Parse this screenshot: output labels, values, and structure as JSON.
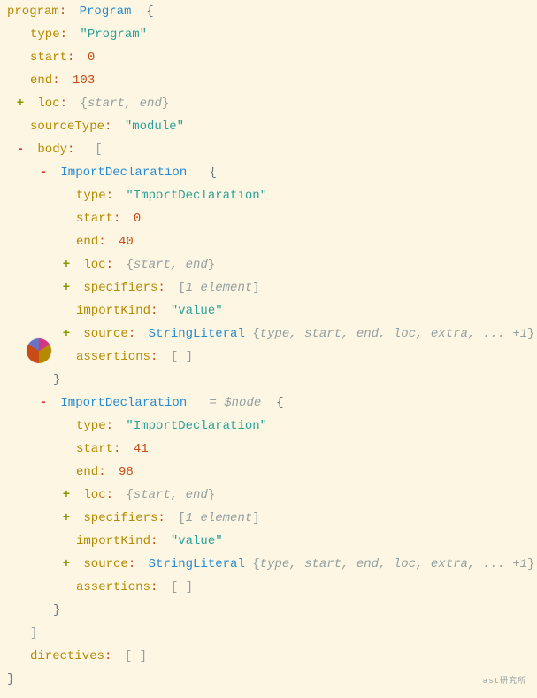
{
  "root": {
    "key": "program",
    "type_name": "Program",
    "open": "{",
    "children": [
      {
        "key": "type",
        "value": "\"Program\"",
        "kind": "string"
      },
      {
        "key": "start",
        "value": "0",
        "kind": "number"
      },
      {
        "key": "end",
        "value": "103",
        "kind": "number"
      },
      {
        "key": "loc",
        "pm": "+",
        "preview": "{start, end}",
        "kind": "object-preview"
      },
      {
        "key": "sourceType",
        "value": "\"module\"",
        "kind": "string"
      },
      {
        "key": "body",
        "pm": "-",
        "value": "[",
        "kind": "array-open",
        "children": [
          {
            "type_name": "ImportDeclaration",
            "pm": "-",
            "open": "{",
            "children": [
              {
                "key": "type",
                "value": "\"ImportDeclaration\"",
                "kind": "string"
              },
              {
                "key": "start",
                "value": "0",
                "kind": "number"
              },
              {
                "key": "end",
                "value": "40",
                "kind": "number"
              },
              {
                "key": "loc",
                "pm": "+",
                "preview": "{start, end}",
                "kind": "object-preview"
              },
              {
                "key": "specifiers",
                "pm": "+",
                "preview": "[1 element]",
                "kind": "array-preview"
              },
              {
                "key": "importKind",
                "value": "\"value\"",
                "kind": "string"
              },
              {
                "key": "source",
                "pm": "+",
                "type_name": "StringLiteral",
                "preview": "{type, start, end, loc, extra, ... +1}",
                "kind": "node-preview"
              },
              {
                "key": "assertions",
                "preview": "[ ]",
                "kind": "empty-array"
              }
            ],
            "close": "}"
          },
          {
            "type_name": "ImportDeclaration",
            "pm": "-",
            "annotation": "= $node",
            "open": "{",
            "children": [
              {
                "key": "type",
                "value": "\"ImportDeclaration\"",
                "kind": "string"
              },
              {
                "key": "start",
                "value": "41",
                "kind": "number"
              },
              {
                "key": "end",
                "value": "98",
                "kind": "number"
              },
              {
                "key": "loc",
                "pm": "+",
                "preview": "{start, end}",
                "kind": "object-preview"
              },
              {
                "key": "specifiers",
                "pm": "+",
                "preview": "[1 element]",
                "kind": "array-preview"
              },
              {
                "key": "importKind",
                "value": "\"value\"",
                "kind": "string"
              },
              {
                "key": "source",
                "pm": "+",
                "type_name": "StringLiteral",
                "preview": "{type, start, end, loc, extra, ... +1}",
                "kind": "node-preview"
              },
              {
                "key": "assertions",
                "preview": "[ ]",
                "kind": "empty-array"
              }
            ],
            "close": "}"
          }
        ],
        "close": "]"
      },
      {
        "key": "directives",
        "preview": "[ ]",
        "kind": "empty-array"
      }
    ],
    "close": "}"
  },
  "watermark": "ast研究所"
}
